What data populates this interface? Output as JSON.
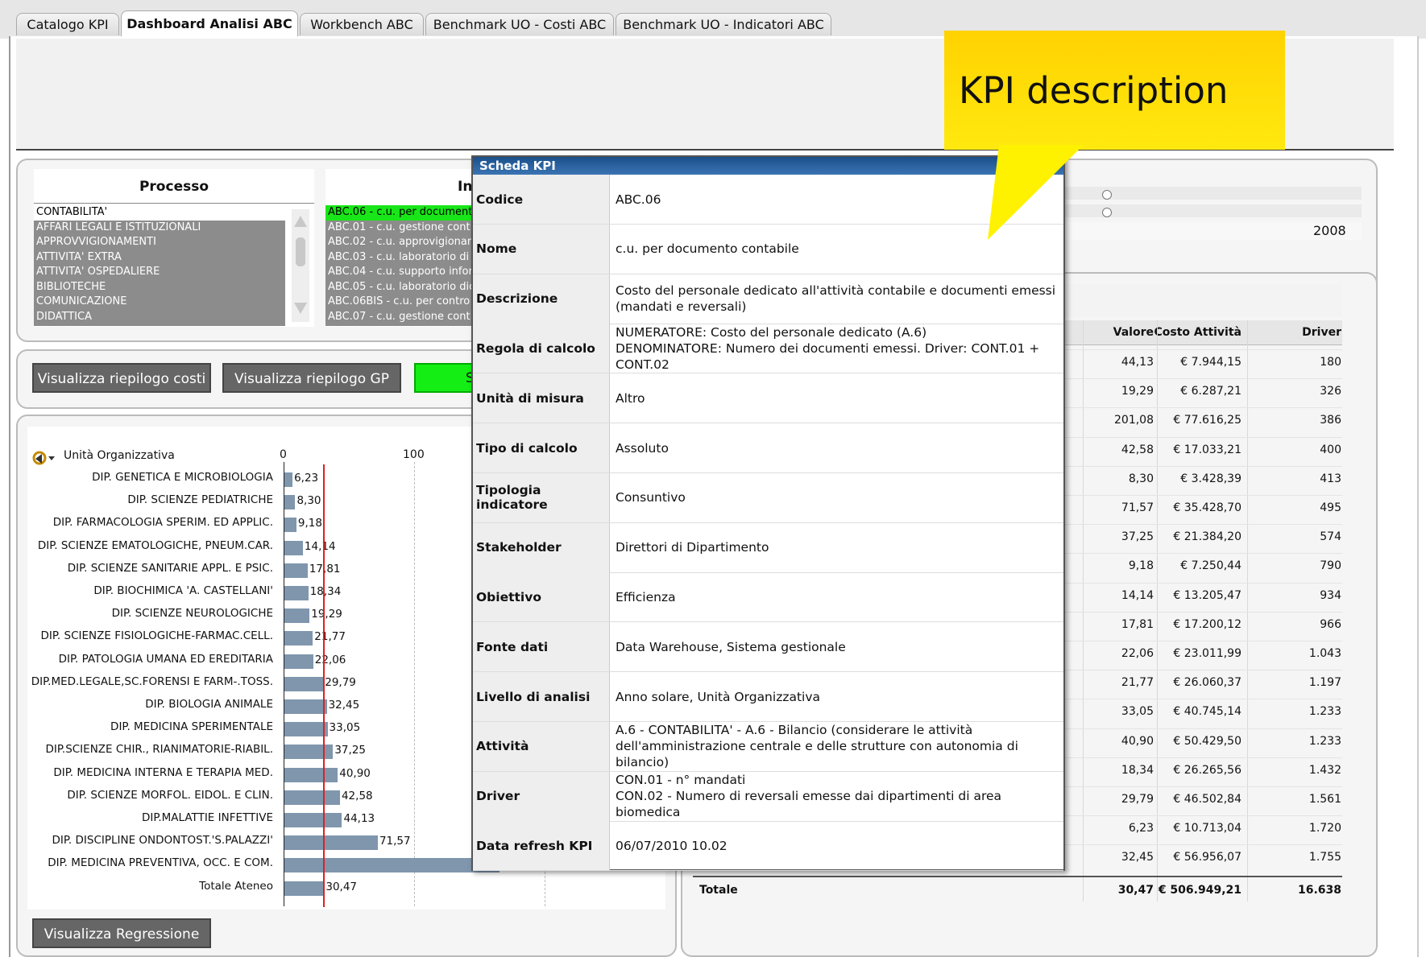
{
  "tabs": [
    "Catalogo KPI",
    "Dashboard Analisi ABC",
    "Workbench ABC",
    "Benchmark UO - Costi ABC",
    "Benchmark UO - Indicatori ABC"
  ],
  "processo": {
    "title": "Processo",
    "items": [
      "CONTABILITA'",
      "AFFARI LEGALI E ISTITUZIONALI",
      "APPROVVIGIONAMENTI",
      "ATTIVITA' EXTRA",
      "ATTIVITA' OSPEDALIERE",
      "BIBLIOTECHE",
      "COMUNICAZIONE",
      "DIDATTICA"
    ]
  },
  "indicatori": {
    "title": "In",
    "items": [
      "ABC.06 - c.u. per document",
      "ABC.01 - c.u. gestione cont",
      "ABC.02 - c.u. approvigionan",
      "ABC.03 - c.u. laboratorio di i",
      "ABC.04 - c.u. supporto infor",
      "ABC.05 - c.u. laboratorio dic",
      "ABC.06BIS - c.u. per contro",
      "ABC.07 - c.u. gestione cont"
    ]
  },
  "buttons": {
    "riepilogo_costi": "Visualizza riepilogo costi",
    "riepilogo_gp": "Visualizza riepilogo GP",
    "green_partial": "S",
    "regressione": "Visualizza Regressione"
  },
  "year": "2008",
  "chart_data": {
    "type": "bar",
    "axis_title": "Unità Organizzativa",
    "ticks": [
      "0",
      "100"
    ],
    "xlim": [
      0,
      250
    ],
    "reference_line": 30.47,
    "categories": [
      "DIP. GENETICA E MICROBIOLOGIA",
      "DIP. SCIENZE PEDIATRICHE",
      "DIP. FARMACOLOGIA SPERIM. ED APPLIC.",
      "DIP. SCIENZE EMATOLOGICHE, PNEUM.CAR.",
      "DIP. SCIENZE SANITARIE APPL. E PSIC.",
      "DIP. BIOCHIMICA 'A. CASTELLANI'",
      "DIP. SCIENZE NEUROLOGICHE",
      "DIP. SCIENZE FISIOLOGICHE-FARMAC.CELL.",
      "DIP. PATOLOGIA UMANA ED EREDITARIA",
      "DIP.MED.LEGALE,SC.FORENSI E FARM-.TOSS.",
      "DIP. BIOLOGIA ANIMALE",
      "DIP. MEDICINA SPERIMENTALE",
      "DIP.SCIENZE CHIR., RIANIMATORIE-RIABIL.",
      "DIP. MEDICINA INTERNA E TERAPIA MED.",
      "DIP. SCIENZE MORFOL. EIDOL. E CLIN.",
      "DIP.MALATTIE INFETTIVE",
      "DIP. DISCIPLINE ONDONTOST.'S.PALAZZI'",
      "DIP. MEDICINA PREVENTIVA, OCC. E COM.",
      "Totale Ateneo"
    ],
    "values": [
      6.23,
      8.3,
      9.18,
      14.14,
      17.81,
      18.34,
      19.29,
      21.77,
      22.06,
      29.79,
      32.45,
      33.05,
      37.25,
      40.9,
      42.58,
      44.13,
      71.57,
      201.08,
      30.47
    ],
    "labels": [
      "6,23",
      "8,30",
      "9,18",
      "14,14",
      "17,81",
      "18,34",
      "19,29",
      "21,77",
      "22,06",
      "29,79",
      "32,45",
      "33,05",
      "37,25",
      "40,90",
      "42,58",
      "44,13",
      "71,57",
      "",
      "30,47"
    ]
  },
  "table": {
    "headers": [
      "Valore",
      "Costo Attività",
      "Driver"
    ],
    "rows": [
      [
        "44,13",
        "€ 7.944,15",
        "180"
      ],
      [
        "19,29",
        "€ 6.287,21",
        "326"
      ],
      [
        "201,08",
        "€ 77.616,25",
        "386"
      ],
      [
        "42,58",
        "€ 17.033,21",
        "400"
      ],
      [
        "8,30",
        "€ 3.428,39",
        "413"
      ],
      [
        "71,57",
        "€ 35.428,70",
        "495"
      ],
      [
        "37,25",
        "€ 21.384,20",
        "574"
      ],
      [
        "9,18",
        "€ 7.250,44",
        "790"
      ],
      [
        "14,14",
        "€ 13.205,47",
        "934"
      ],
      [
        "17,81",
        "€ 17.200,12",
        "966"
      ],
      [
        "22,06",
        "€ 23.011,99",
        "1.043"
      ],
      [
        "21,77",
        "€ 26.060,37",
        "1.197"
      ],
      [
        "33,05",
        "€ 40.745,14",
        "1.233"
      ],
      [
        "40,90",
        "€ 50.429,50",
        "1.233"
      ],
      [
        "18,34",
        "€ 26.265,56",
        "1.432"
      ],
      [
        "29,79",
        "€ 46.502,84",
        "1.561"
      ],
      [
        "6,23",
        "€ 10.713,04",
        "1.720"
      ],
      [
        "32,45",
        "€ 56.956,07",
        "1.755"
      ]
    ],
    "total": {
      "label": "Totale",
      "valore": "30,47",
      "costo": "€ 506.949,21",
      "driver": "16.638"
    }
  },
  "modal": {
    "title": "Scheda KPI",
    "rows": [
      {
        "key": "Codice",
        "value": "ABC.06"
      },
      {
        "key": "Nome",
        "value": "c.u. per documento contabile"
      },
      {
        "key": "Descrizione",
        "value": "Costo del personale dedicato all'attività contabile e documenti emessi\n(mandati e reversali)"
      },
      {
        "key": "Regola di calcolo",
        "value": "NUMERATORE: Costo del personale dedicato (A.6)\nDENOMINATORE: Numero dei documenti emessi. Driver: CONT.01 +\nCONT.02"
      },
      {
        "key": "Unità di misura",
        "value": "Altro"
      },
      {
        "key": "Tipo di calcolo",
        "value": "Assoluto"
      },
      {
        "key": "Tipologia indicatore",
        "value": "Consuntivo"
      },
      {
        "key": "Stakeholder",
        "value": "Direttori di Dipartimento"
      },
      {
        "key": "Obiettivo",
        "value": "Efficienza"
      },
      {
        "key": "Fonte dati",
        "value": "Data Warehouse, Sistema gestionale"
      },
      {
        "key": "Livello di analisi",
        "value": "Anno solare, Unità Organizzativa"
      },
      {
        "key": "Attività",
        "value": "A.6 - CONTABILITA' - A.6 - Bilancio (considerare le attività\ndell'amministrazione centrale e delle strutture con autonomia di bilancio)"
      },
      {
        "key": "Driver",
        "value": "CON.01 - n° mandati\nCON.02 - Numero di reversali emesse dai dipartimenti di area biomedica"
      },
      {
        "key": "Data refresh KPI",
        "value": "06/07/2010 10.02"
      }
    ]
  },
  "callout": "KPI description"
}
